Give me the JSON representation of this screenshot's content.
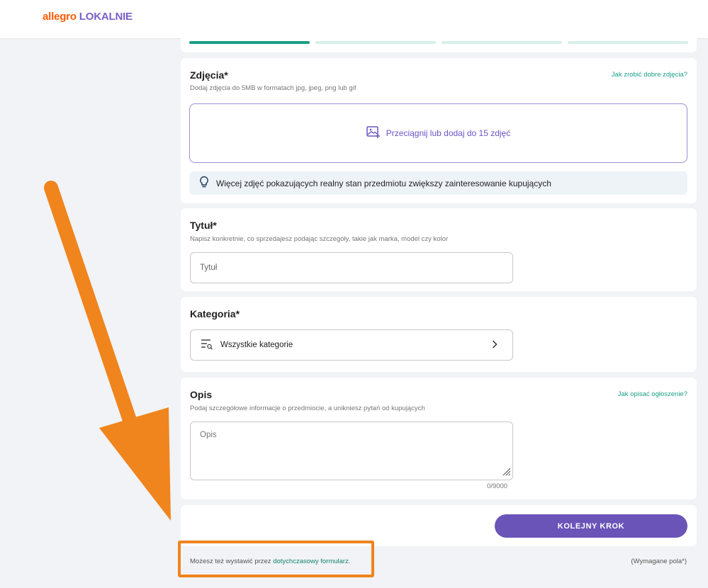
{
  "brand": {
    "part1": "allegro",
    "part2": "LOKALNIE",
    "colors": {
      "allegro": "#ff5a00",
      "lokalnie": "#7b5fc8"
    }
  },
  "progress": {
    "steps": 4,
    "active_step": 1
  },
  "photos": {
    "title": "Zdjęcia*",
    "subtitle": "Dodaj zdjęcia do 5MB w formatach jpg, jpeg, png lub gif",
    "help_link": "Jak zrobić dobre zdjęcia?",
    "dropzone_label": "Przeciągnij lub dodaj do 15 zdjęć",
    "dropzone_icon": "image-add-icon",
    "tip_icon": "lightbulb-icon",
    "tip": "Więcej zdjęć pokazujących realny stan przedmiotu zwiększy zainteresowanie kupujących"
  },
  "title_section": {
    "title": "Tytuł*",
    "subtitle": "Napisz konkretnie, co sprzedajesz podając szczegóły, takie jak marka, model czy kolor",
    "placeholder": "Tytuł"
  },
  "category": {
    "title": "Kategoria*",
    "select_label": "Wszystkie kategorie",
    "select_icon": "category-search-icon"
  },
  "description": {
    "title": "Opis",
    "help_link": "Jak opisać ogłoszenie?",
    "subtitle": "Podaj szczegółowe informacje o przedmiocie, a unikniesz pytań od kupujących",
    "placeholder": "Opis",
    "counter": "0/9000"
  },
  "next_button": "KOLEJNY KROK",
  "footer": {
    "prefix": "Możesz też wystawić przez ",
    "link": "dotychczasowy formularz",
    "suffix": ".",
    "required": "(Wymagane pola*)"
  },
  "colors": {
    "accent": "#1a9e88",
    "primary_button": "#6a54b8",
    "annotation": "#f0841d"
  }
}
